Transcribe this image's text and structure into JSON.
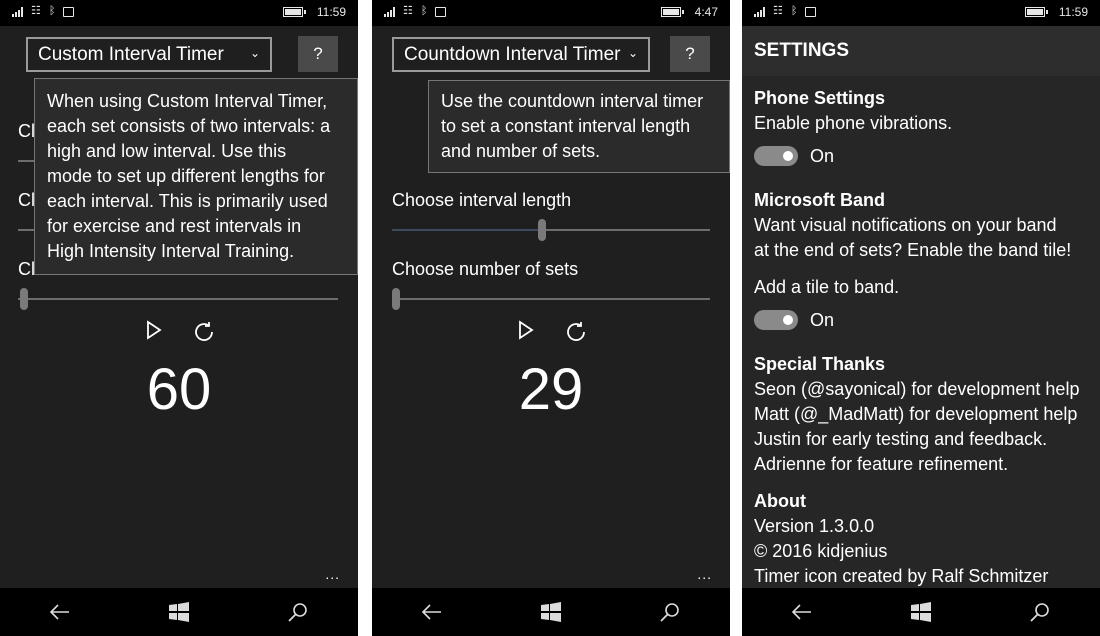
{
  "screens": [
    {
      "status": {
        "time": "11:59"
      },
      "mode_select": {
        "value": "Custom Interval Timer"
      },
      "help_label": "?",
      "tooltip_lines": [
        "When using Custom Interval Timer,",
        "each set consists of two intervals: a",
        "high and low interval. Use this",
        "mode to set up different lengths for",
        "each interval. This is primarily used",
        "for exercise and rest intervals in",
        "High Intensity Interval Training."
      ],
      "hidden_label_fragments": [
        "Cl",
        "Cl",
        "Cl"
      ],
      "count": "60",
      "more": "..."
    },
    {
      "status": {
        "time": "4:47"
      },
      "mode_select": {
        "value": "Countdown Interval Timer"
      },
      "help_label": "?",
      "tooltip_lines": [
        "Use the countdown interval timer",
        "to set a constant interval length",
        "and number of sets."
      ],
      "sliders": [
        {
          "label": "Choose interval length",
          "level": 0.47
        },
        {
          "label": "Choose number of sets",
          "level": 0.0
        }
      ],
      "count": "29",
      "more": "..."
    },
    {
      "status": {
        "time": "11:59"
      },
      "title": "SETTINGS",
      "phone": {
        "heading": "Phone Settings",
        "text": "Enable phone vibrations.",
        "toggle": "On"
      },
      "band": {
        "heading": "Microsoft Band",
        "text_lines": [
          "Want visual notifications on your band",
          "at the end of sets? Enable the band tile!"
        ],
        "tile_text": "Add a tile to band.",
        "toggle": "On"
      },
      "thanks": {
        "heading": "Special Thanks",
        "lines": [
          "Seon (@sayonical) for development help",
          "Matt (@_MadMatt) for development help",
          "Justin for early testing and feedback.",
          "Adrienne for feature refinement."
        ]
      },
      "about": {
        "heading": "About",
        "lines": [
          "Version 1.3.0.0",
          "© 2016 kidjenius",
          "Timer icon created by Ralf Schmitzer"
        ]
      }
    }
  ],
  "icons": {
    "back": "back-arrow-icon",
    "home": "windows-logo-icon",
    "search": "search-icon",
    "play": "play-icon",
    "reset": "refresh-icon"
  }
}
